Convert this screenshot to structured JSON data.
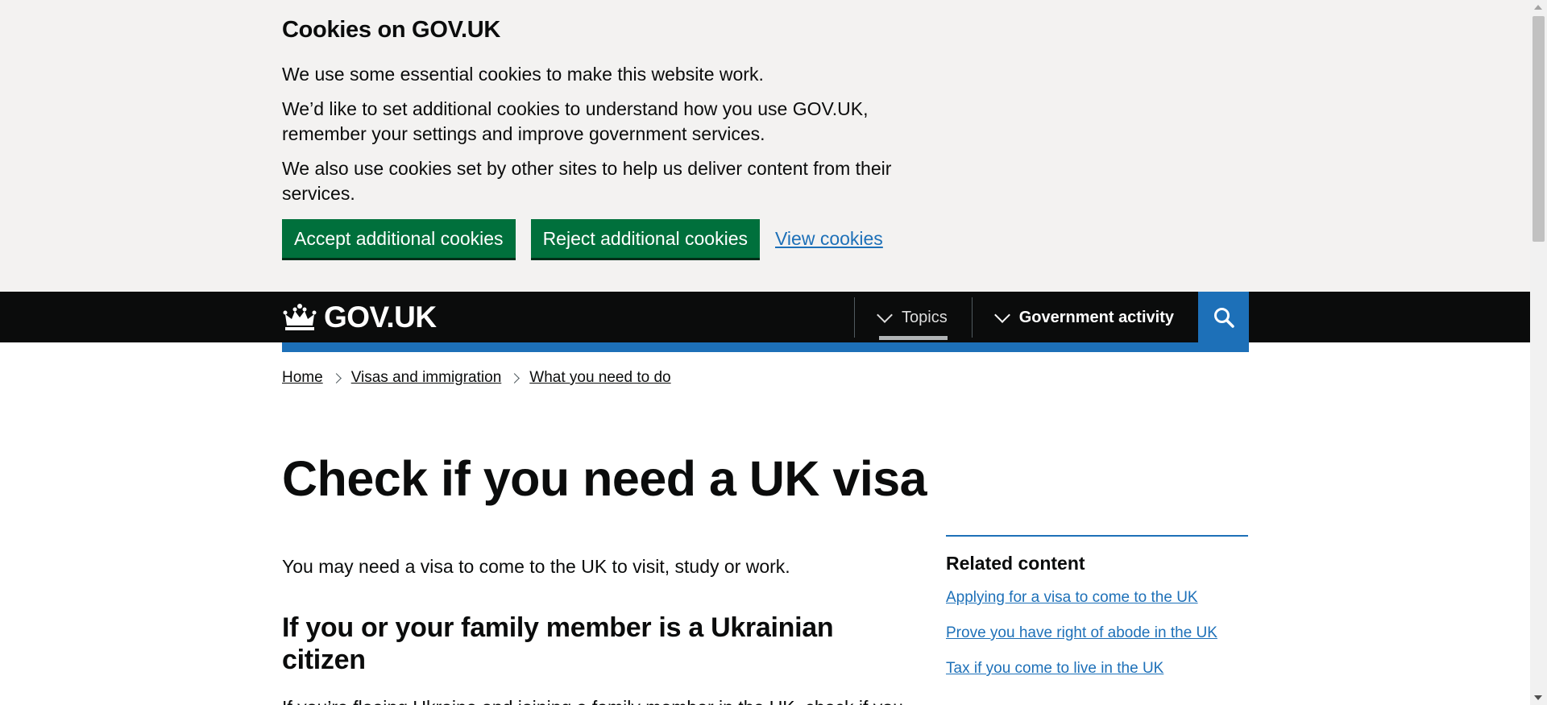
{
  "cookie_banner": {
    "title": "Cookies on GOV.UK",
    "para1": "We use some essential cookies to make this website work.",
    "para2": "We’d like to set additional cookies to understand how you use GOV.UK, remember your settings and improve government services.",
    "para3": "We also use cookies set by other sites to help us deliver content from their services.",
    "accept_label": "Accept additional cookies",
    "reject_label": "Reject additional cookies",
    "view_label": "View cookies"
  },
  "header": {
    "logo_text": "GOV.UK",
    "nav_topics": "Topics",
    "nav_government": "Government activity",
    "search_icon": "search-icon"
  },
  "breadcrumb": [
    "Home",
    "Visas and immigration",
    "What you need to do"
  ],
  "page": {
    "title": "Check if you need a UK visa",
    "lead": "You may need a visa to come to the UK to visit, study or work.",
    "h2": "If you or your family member is a Ukrainian citizen",
    "body": "If you’re fleeing Ukraine and joining a family member in the UK, check if you"
  },
  "related": {
    "title": "Related content",
    "links": [
      "Applying for a visa to come to the UK",
      "Prove you have right of abode in the UK",
      "Tax if you come to live in the UK"
    ]
  },
  "colors": {
    "green": "#00703c",
    "blue": "#1d70b8",
    "black": "#0b0c0c",
    "banner_bg": "#f3f2f1"
  }
}
